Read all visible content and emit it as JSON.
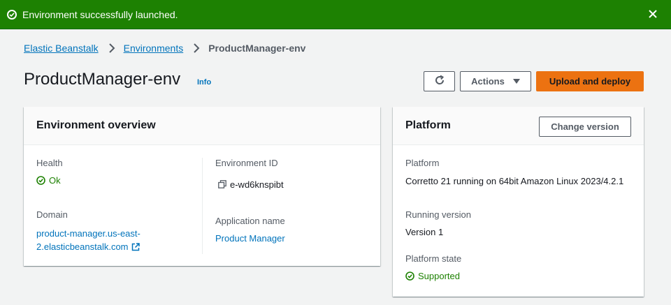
{
  "flash": {
    "message": "Environment successfully launched.",
    "color": "#1d8102"
  },
  "breadcrumb": {
    "items": [
      "Elastic Beanstalk",
      "Environments"
    ],
    "current": "ProductManager-env"
  },
  "header": {
    "title": "ProductManager-env",
    "info_label": "Info",
    "actions_label": "Actions",
    "upload_label": "Upload and deploy",
    "accent": "#ec7211"
  },
  "overview": {
    "title": "Environment overview",
    "health_label": "Health",
    "health_value": "Ok",
    "domain_label": "Domain",
    "domain_line1": "product-manager.us-east-",
    "domain_line2": "2.elasticbeanstalk.com",
    "env_id_label": "Environment ID",
    "env_id_value": "e-wd6knspibt",
    "app_name_label": "Application name",
    "app_name_value": "Product Manager"
  },
  "platform": {
    "title": "Platform",
    "change_label": "Change version",
    "platform_label": "Platform",
    "platform_value": "Corretto 21 running on 64bit Amazon Linux 2023/4.2.1",
    "running_label": "Running version",
    "running_value": "Version 1",
    "state_label": "Platform state",
    "state_value": "Supported"
  }
}
